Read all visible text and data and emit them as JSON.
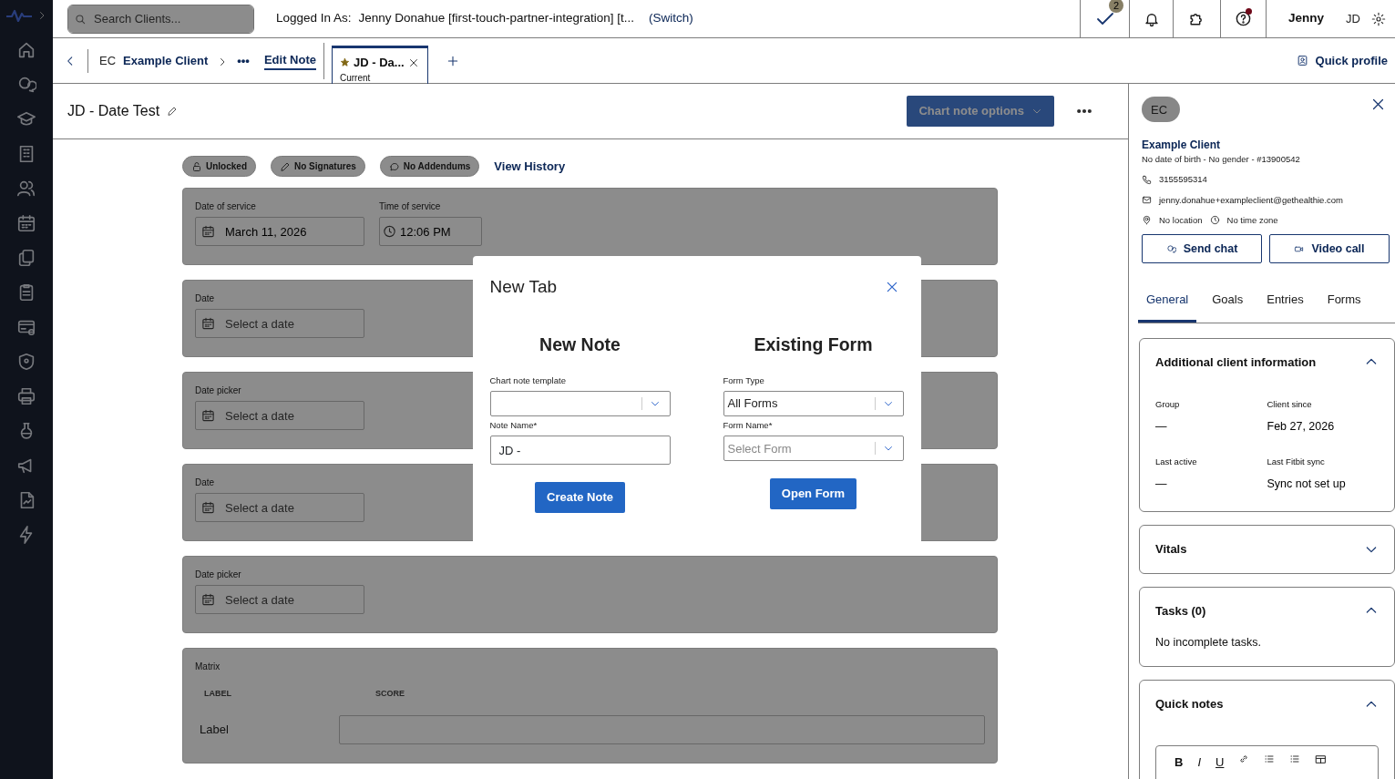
{
  "top_bar": {
    "search": {
      "placeholder": "Search Clients..."
    },
    "logged_in_label": "Logged In As:",
    "logged_in_user": "Jenny Donahue [first-touch-partner-integration] [t...",
    "switch_link": "(Switch)",
    "tasks_count": "2",
    "help_unread": true,
    "user_name": "Jenny",
    "user_initials": "JD"
  },
  "tab_bar": {
    "breadcrumb": {
      "initials": "EC",
      "client": "Example Client",
      "more": "•••",
      "current": "Edit Note"
    },
    "tabs": [
      {
        "title": "JD - Da...",
        "subtitle": "Current",
        "selected": true
      }
    ],
    "quick_profile": "Quick profile"
  },
  "note": {
    "title": "JD - Date Test",
    "options_button": "Chart note options",
    "chips": [
      {
        "kind": "lock",
        "label": "Unlocked"
      },
      {
        "kind": "pen",
        "label": "No Signatures"
      },
      {
        "kind": "comment",
        "label": "No Addendums"
      }
    ],
    "view_history": "View History",
    "sections": [
      {
        "fields": [
          {
            "kind": "date",
            "label": "Date of service",
            "value": "March 11, 2026"
          },
          {
            "kind": "time",
            "label": "Time of service",
            "value": "12:06 PM"
          }
        ]
      },
      {
        "fields": [
          {
            "kind": "date",
            "label": "Date",
            "placeholder": "Select a date"
          }
        ]
      },
      {
        "fields": [
          {
            "kind": "date",
            "label": "Date picker",
            "placeholder": "Select a date"
          }
        ]
      },
      {
        "fields": [
          {
            "kind": "date",
            "label": "Date",
            "placeholder": "Select a date"
          }
        ]
      },
      {
        "fields": [
          {
            "kind": "date",
            "label": "Date picker",
            "placeholder": "Select a date"
          }
        ]
      }
    ],
    "matrix": {
      "label": "Matrix",
      "columns": [
        "LABEL",
        "SCORE"
      ],
      "rows": [
        {
          "label": "Label"
        }
      ]
    }
  },
  "profile": {
    "initials": "EC",
    "name": "Example Client",
    "meta": "No date of birth - No gender - ",
    "record_id": "#13900542",
    "phone": "3155595314",
    "email": "jenny.donahue+exampleclient@gethealthie.com",
    "location": "No location",
    "time_zone": "No time zone",
    "buttons": [
      {
        "kind": "chat",
        "label": "Send chat"
      },
      {
        "kind": "video",
        "label": "Video call"
      }
    ],
    "tabs": [
      {
        "label": "General",
        "selected": true
      },
      {
        "label": "Goals",
        "selected": false
      },
      {
        "label": "Entries",
        "selected": false
      },
      {
        "label": "Forms",
        "selected": false
      }
    ],
    "cards": [
      {
        "kind": "info",
        "title": "Additional client information",
        "expanded": true,
        "fields": [
          {
            "label": "Group",
            "value": "—"
          },
          {
            "label": "Client since",
            "value": "Feb 27, 2026"
          },
          {
            "label": "Last active",
            "value": "—"
          },
          {
            "label": "Last Fitbit sync",
            "value": "Sync not set up"
          }
        ]
      },
      {
        "title": "Vitals",
        "expanded": false
      },
      {
        "kind": "text",
        "title": "Tasks (0)",
        "expanded": true,
        "text": "No incomplete tasks."
      },
      {
        "kind": "editor",
        "title": "Quick notes",
        "expanded": true,
        "toolbar": [
          "B",
          "I",
          "U"
        ]
      }
    ]
  },
  "modal": {
    "title": "New Tab",
    "columns": [
      {
        "heading": "New Note",
        "fields": [
          {
            "kind": "select",
            "label": "Chart note template"
          },
          {
            "kind": "input",
            "label": "Note Name*",
            "value": "JD -"
          }
        ],
        "button": "Create Note"
      },
      {
        "heading": "Existing Form",
        "fields": [
          {
            "kind": "select",
            "label": "Form Type",
            "value": "All Forms"
          },
          {
            "kind": "select",
            "label": "Form Name*",
            "placeholder": "Select Form"
          }
        ],
        "button": "Open Form"
      }
    ]
  }
}
